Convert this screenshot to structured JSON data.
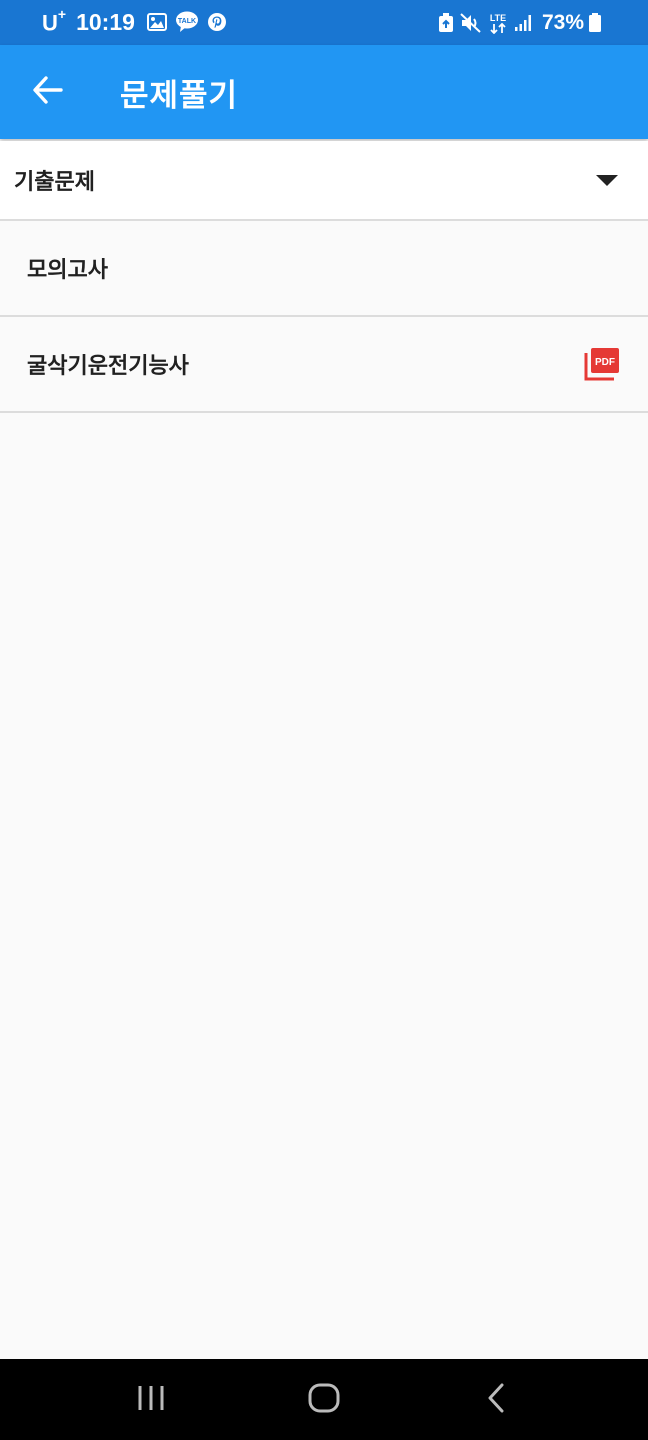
{
  "status_bar": {
    "carrier": "U",
    "carrier_sup": "+",
    "time": "10:19",
    "battery": "73%",
    "left_icons": [
      "gallery-icon",
      "kakaotalk-icon",
      "pinterest-icon"
    ],
    "right_icons": [
      "nfc-icon",
      "mute-icon",
      "lte-icon",
      "signal-icon",
      "battery-icon"
    ],
    "talk_label": "TALK",
    "lte_label": "LTE"
  },
  "app_bar": {
    "title": "문제풀기",
    "background": "#2196f3"
  },
  "dropdown": {
    "selected": "기출문제"
  },
  "list": {
    "items": [
      {
        "label": "모의고사",
        "icon": null
      },
      {
        "label": "굴삭기운전기능사",
        "icon": "pdf-icon"
      }
    ]
  },
  "pdf_icon_label": "PDF",
  "colors": {
    "status_bar": "#1976d2",
    "app_bar": "#2196f3",
    "pdf_red": "#e53935",
    "background": "#fafafa"
  },
  "nav_bar": {
    "buttons": [
      "recent-apps-icon",
      "home-icon",
      "back-nav-icon"
    ]
  }
}
